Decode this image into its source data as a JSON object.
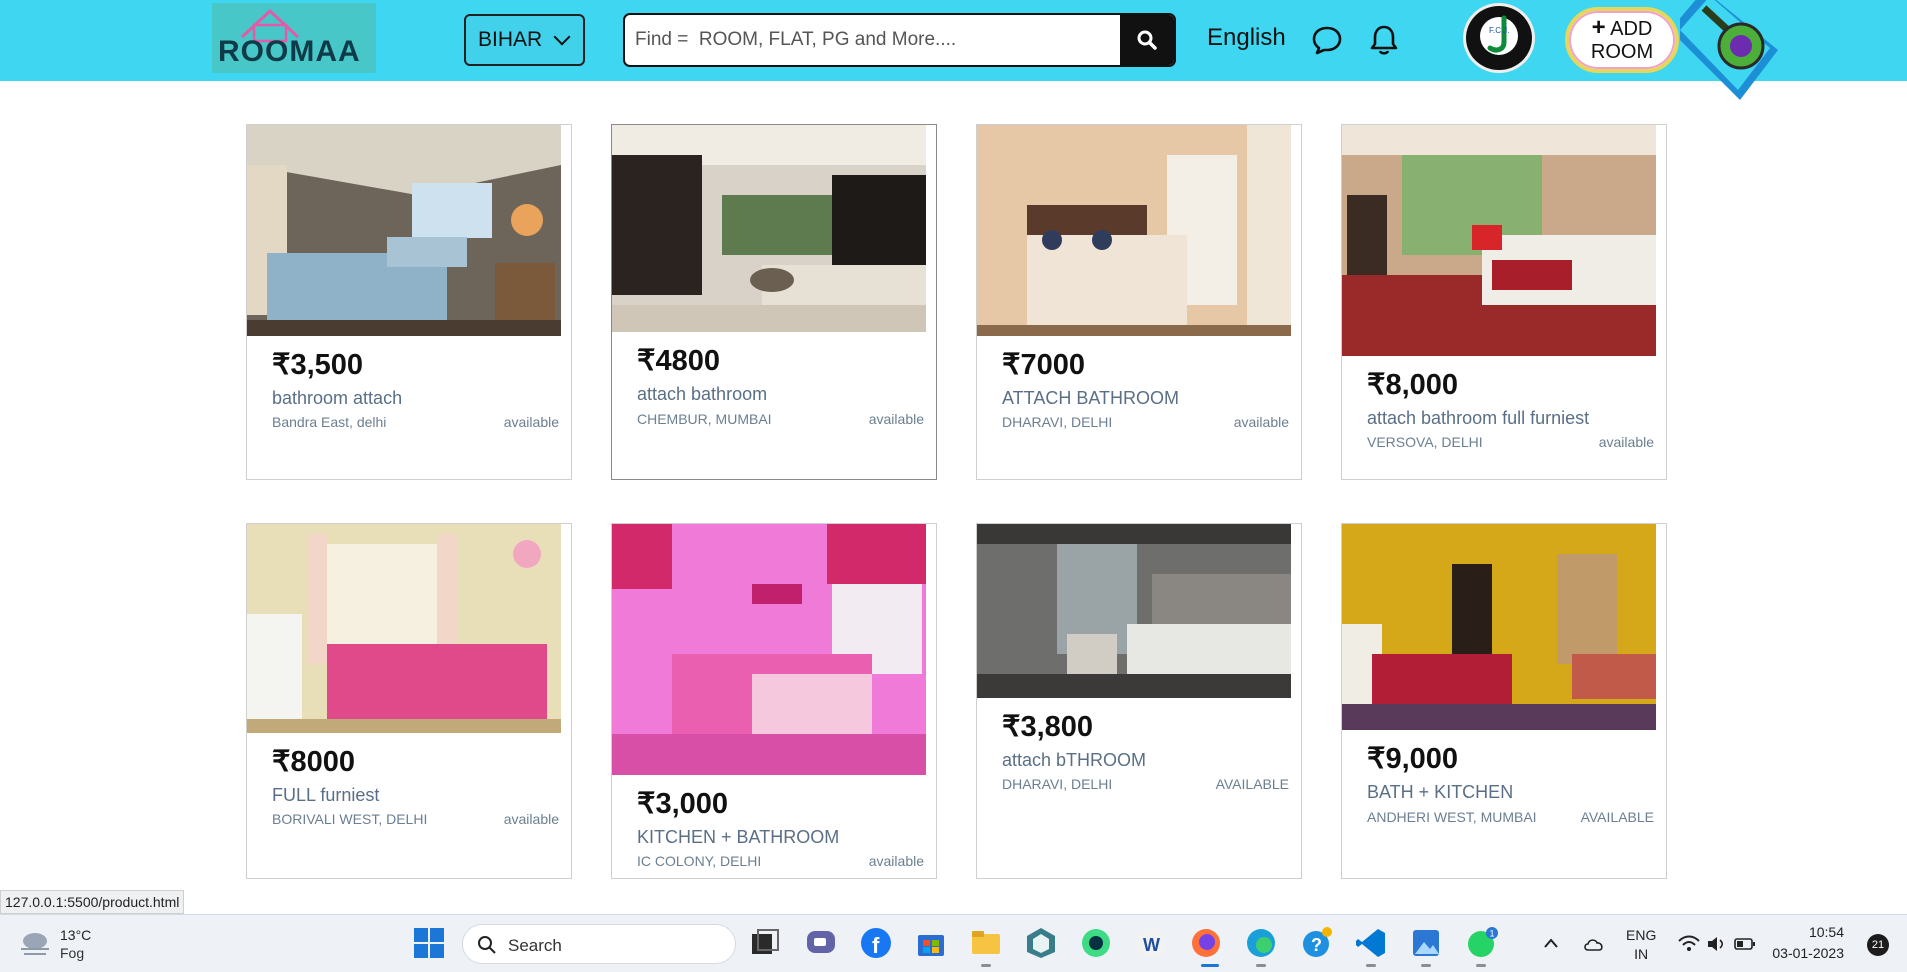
{
  "header": {
    "logo_text": "ROOMAA",
    "state_select": "BIHAR",
    "search_placeholder": "Find =  ROOM, FLAT, PG and More....",
    "language": "English",
    "avatar_text": "F.C.J.",
    "add_room_plus": "+",
    "add_room_line1": "ADD",
    "add_room_line2": "ROOM"
  },
  "listings": [
    {
      "price": "₹3,500",
      "desc": "bathroom attach",
      "location": "Bandra East, delhi",
      "status": "available",
      "image": "bedroom-photo"
    },
    {
      "price": "₹4800",
      "desc": "attach bathroom",
      "location": "CHEMBUR, MUMBAI",
      "status": "available",
      "image": "living-room-photo"
    },
    {
      "price": "₹7000",
      "desc": "ATTACH BATHROOM",
      "location": "DHARAVI, DELHI",
      "status": "available",
      "image": "bedroom-photo"
    },
    {
      "price": "₹8,000",
      "desc": "attach bathroom full furniest",
      "location": "VERSOVA, DELHI",
      "status": "available",
      "image": "hotel-room-photo"
    },
    {
      "price": "₹8000",
      "desc": "FULL furniest",
      "location": "BORIVALI WEST, DELHI",
      "status": "available",
      "image": "kids-bedroom-photo"
    },
    {
      "price": "₹3,000",
      "desc": "KITCHEN + BATHROOM",
      "location": "IC COLONY, DELHI",
      "status": "available",
      "image": "pink-bedroom-photo"
    },
    {
      "price": "₹3,800",
      "desc": "attach bTHROOM",
      "location": "DHARAVI, DELHI",
      "status": "AVAILABLE",
      "image": "twin-bed-room-photo"
    },
    {
      "price": "₹9,000",
      "desc": "BATH + KITCHEN",
      "location": "ANDHERI WEST, MUMBAI",
      "status": "AVAILABLE",
      "image": "yellow-bedroom-photo"
    }
  ],
  "status_url": "127.0.0.1:5500/product.html",
  "taskbar": {
    "weather_temp": "13°C",
    "weather_cond": "Fog",
    "search_label": "Search",
    "lang_line1": "ENG",
    "lang_line2": "IN",
    "time": "10:54",
    "date": "03-01-2023",
    "notification_count": "21",
    "whatsapp_badge": "1"
  },
  "colors": {
    "header_bg": "#3ed6f0",
    "text_dark": "#111111",
    "desc_blue": "#5a6f86"
  }
}
